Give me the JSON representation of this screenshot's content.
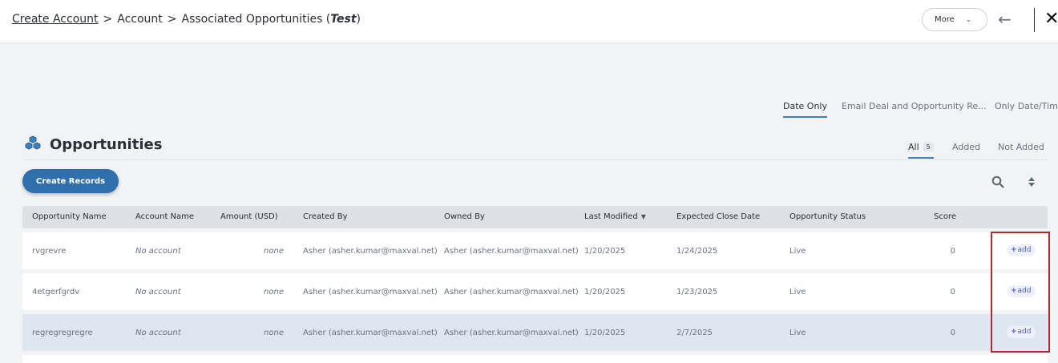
{
  "breadcrumb": {
    "items": [
      "Create Account",
      "Account",
      "Associated Opportunities ("
    ],
    "context": "Test",
    "close_paren": ")",
    "separator": ">"
  },
  "header": {
    "more_label": "More",
    "more_chevron": "⌄",
    "back_icon": "arrow-left-icon",
    "close_icon": "close-icon",
    "back_glyph": "←",
    "close_glyph": "✕"
  },
  "view_tabs": [
    {
      "label": "Date Only",
      "active": true
    },
    {
      "label": "Email Deal and Opportunity Re...",
      "active": false
    },
    {
      "label": "Only Date/Time",
      "active": false
    }
  ],
  "section": {
    "title": "Opportunities",
    "icon": "cubes-icon"
  },
  "filter_tabs": [
    {
      "label": "All",
      "count": "5",
      "active": true
    },
    {
      "label": "Added",
      "active": false
    },
    {
      "label": "Not Added",
      "active": false
    }
  ],
  "actions": {
    "create_records": "Create Records"
  },
  "table": {
    "columns": [
      "Opportunity Name",
      "Account Name",
      "Amount (USD)",
      "Created By",
      "Owned By",
      "Last Modified",
      "Expected Close Date",
      "Opportunity Status",
      "Score"
    ],
    "sort_caret": "▼",
    "add_label": "add",
    "add_plus": "+",
    "rows": [
      {
        "name": "rvgrevre",
        "account": "No account",
        "amount": "none",
        "created_by": "Asher (asher.kumar@maxval.net)",
        "owned_by": "Asher (asher.kumar@maxval.net)",
        "last_modified": "1/20/2025",
        "close_date": "1/24/2025",
        "status": "Live",
        "score": "0"
      },
      {
        "name": "4etgerfgrdv",
        "account": "No account",
        "amount": "none",
        "created_by": "Asher (asher.kumar@maxval.net)",
        "owned_by": "Asher (asher.kumar@maxval.net)",
        "last_modified": "1/20/2025",
        "close_date": "1/23/2025",
        "status": "Live",
        "score": "0"
      },
      {
        "name": "regregregregre",
        "account": "No account",
        "amount": "none",
        "created_by": "Asher (asher.kumar@maxval.net)",
        "owned_by": "Asher (asher.kumar@maxval.net)",
        "last_modified": "1/20/2025",
        "close_date": "2/7/2025",
        "status": "Live",
        "score": "0"
      }
    ]
  },
  "colors": {
    "accent": "#2f6fad",
    "highlight": "#b3262b",
    "selected_row": "#dde6f1"
  }
}
